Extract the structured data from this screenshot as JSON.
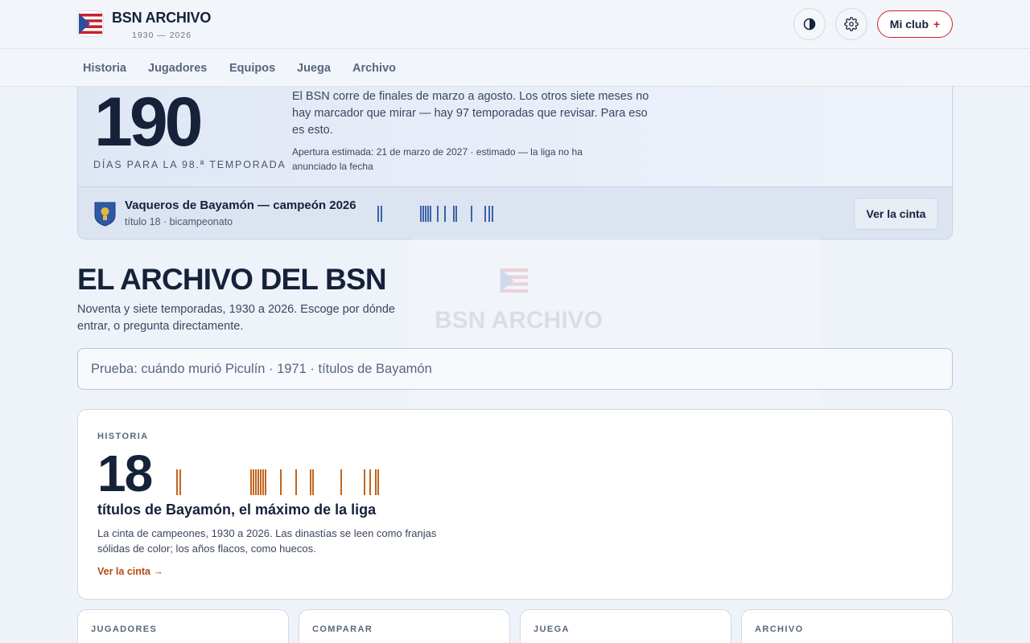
{
  "brand": {
    "title": "BSN ARCHIVO",
    "years": "1930 — 2026"
  },
  "header": {
    "theme_icon": "contrast-icon",
    "settings_icon": "gear-icon",
    "club_label": "Mi club",
    "club_plus": "+"
  },
  "nav": {
    "items": [
      {
        "label": "Historia"
      },
      {
        "label": "Jugadores"
      },
      {
        "label": "Equipos"
      },
      {
        "label": "Juega"
      },
      {
        "label": "Archivo"
      }
    ]
  },
  "countdown": {
    "days": "190",
    "label": "DÍAS PARA LA 98.ª TEMPORADA",
    "text": "El BSN corre de finales de marzo a agosto. Los otros siete meses no hay marcador que mirar — hay 97 temporadas que revisar. Para eso es esto.",
    "note": "Apertura estimada: 21 de marzo de 2027 · estimado — la liga no ha anunciado la fecha"
  },
  "champion": {
    "title": "Vaqueros de Bayamón — campeón 2026",
    "subtitle": "título 18 · bicampeonato",
    "button": "Ver la cinta",
    "tape_color": "#3a62a8"
  },
  "archive": {
    "title": "EL ARCHIVO DEL BSN",
    "subtitle": "Noventa y siete temporadas, 1930 a 2026. Escoge por dónde entrar, o pregunta directamente."
  },
  "search": {
    "placeholder": "Prueba: cuándo murió Piculín · 1971 · títulos de Bayamón"
  },
  "historia": {
    "kicker": "HISTORIA",
    "number": "18",
    "heading": "títulos de Bayamón, el máximo de la liga",
    "description": "La cinta de campeones, 1930 a 2026. Las dinastías se leen como franjas sólidas de color; los años flacos, como huecos.",
    "link": "Ver la cinta",
    "link_arrow": "→",
    "tape_color": "#c2651f"
  },
  "cards": [
    {
      "kicker": "JUGADORES"
    },
    {
      "kicker": "COMPARAR"
    },
    {
      "kicker": "JUEGA"
    },
    {
      "kicker": "ARCHIVO"
    }
  ],
  "colors": {
    "brand_red": "#c8202f",
    "navy": "#16213a",
    "accent_orange": "#b64a12"
  }
}
